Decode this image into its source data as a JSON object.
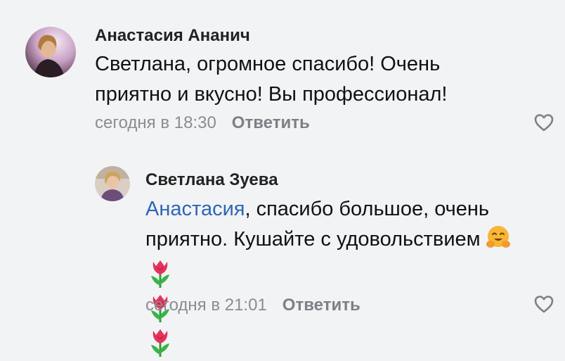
{
  "comments": [
    {
      "author": "Анастасия Ананич",
      "text_lines": [
        "Светлана, огромное спасибо! Очень",
        "приятно и вкусно! Вы профессионал!"
      ],
      "time": "сегодня в 18:30",
      "reply_label": "Ответить"
    },
    {
      "author": "Светлана Зуева",
      "mention": "Анастасия",
      "text_line1_rest": ", спасибо большое, очень",
      "text_line2": "приятно. Кушайте с удовольствием",
      "time": "сегодня в 21:01",
      "reply_label": "Ответить"
    }
  ],
  "icons": {
    "like": "heart-outline-icon",
    "hug": "hugging-face-emoji",
    "tulip": "tulip-emoji"
  },
  "colors": {
    "background": "#f2f3f5",
    "mention": "#2f66b5",
    "meta": "#8a8d91",
    "reply": "#7d8085"
  }
}
